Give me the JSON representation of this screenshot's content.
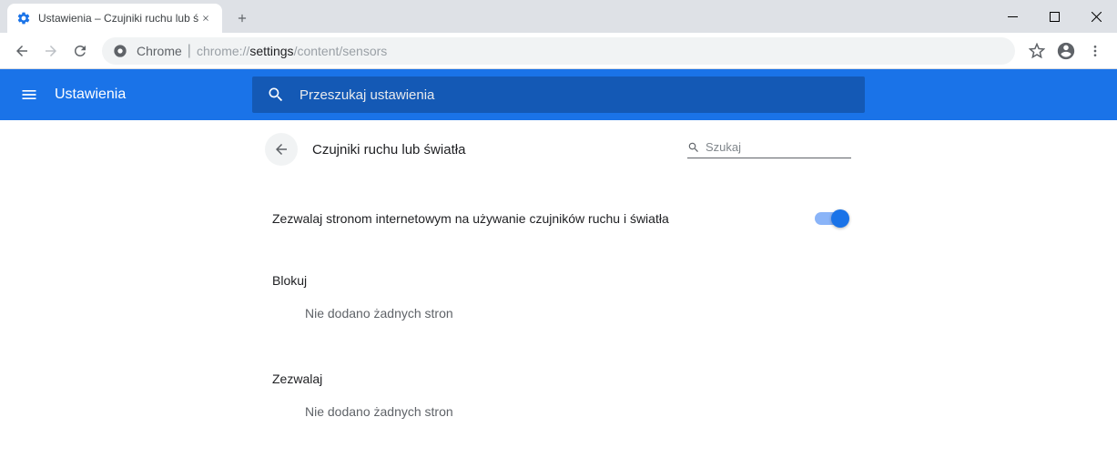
{
  "window": {
    "tab_title": "Ustawienia – Czujniki ruchu lub ś"
  },
  "omnibox": {
    "prefix": "Chrome",
    "url_gray1": "chrome://",
    "url_dark": "settings",
    "url_gray2": "/content/sensors"
  },
  "header": {
    "title": "Ustawienia",
    "search_placeholder": "Przeszukaj ustawienia"
  },
  "subheader": {
    "title": "Czujniki ruchu lub światła",
    "search_placeholder": "Szukaj"
  },
  "main_toggle": {
    "label": "Zezwalaj stronom internetowym na używanie czujników ruchu i światła",
    "on": true
  },
  "sections": {
    "block": {
      "title": "Blokuj",
      "empty": "Nie dodano żadnych stron"
    },
    "allow": {
      "title": "Zezwalaj",
      "empty": "Nie dodano żadnych stron"
    }
  }
}
